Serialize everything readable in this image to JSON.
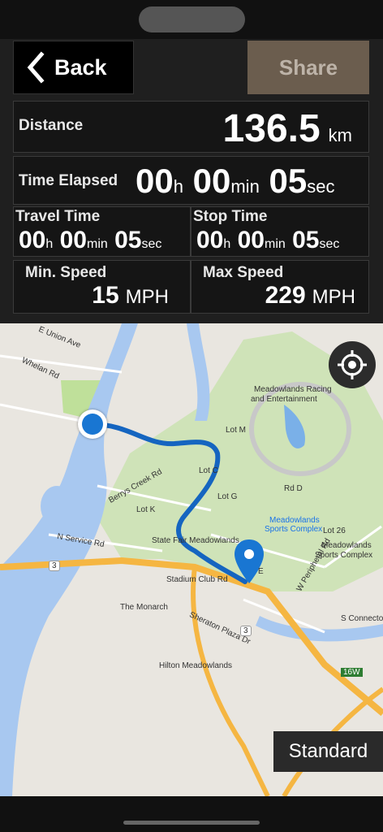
{
  "header": {
    "back_label": "Back",
    "share_label": "Share"
  },
  "stats": {
    "distance": {
      "label": "Distance",
      "value": "136.5",
      "unit": "km"
    },
    "time_elapsed": {
      "label": "Time Elapsed",
      "h": "00",
      "h_unit": "h",
      "min": "00",
      "min_unit": "min",
      "sec": "05",
      "sec_unit": "sec"
    },
    "travel_time": {
      "label": "Travel Time",
      "h": "00",
      "h_unit": "h",
      "min": "00",
      "min_unit": "min",
      "sec": "05",
      "sec_unit": "sec"
    },
    "stop_time": {
      "label": "Stop Time",
      "h": "00",
      "h_unit": "h",
      "min": "00",
      "min_unit": "min",
      "sec": "05",
      "sec_unit": "sec"
    },
    "min_speed": {
      "label": "Min. Speed",
      "value": "15",
      "unit": "MPH"
    },
    "max_speed": {
      "label": "Max Speed",
      "value": "229",
      "unit": "MPH"
    }
  },
  "map": {
    "labels": {
      "e_union_ave": "E Union Ave",
      "whelan_rd": "Whelan Rd",
      "meadowlands_racing": "Meadowlands Racing",
      "and_entertainment": "and Entertainment",
      "lot_m": "Lot M",
      "lot_g": "Lot G",
      "lot_k": "Lot K",
      "lot_c": "Lot C",
      "state_fair": "State Fair Meadowlands",
      "meadowlands_sports_complex": "Meadowlands",
      "sports_complex_2": "Sports Complex",
      "lot_26": "Lot 26",
      "meadowlands_sc_right_1": "Meadowlands",
      "meadowlands_sc_right_2": "Sports Complex",
      "n_service_rd": "N Service Rd",
      "berrys_creek_rd": "Berrys Creek Rd",
      "stadium_club_rd": "Stadium Club Rd",
      "the_monarch": "The Monarch",
      "sheraton_plaza_dr": "Sheraton Plaza Dr",
      "hilton_meadowlands": "Hilton Meadowlands",
      "s_connector": "S Connector",
      "w_peripheral_rd": "W Peripheral Rd",
      "rd_d": "Rd D",
      "lot_e": "E",
      "route_3_a": "3",
      "route_3_b": "3",
      "route_16w": "16W"
    },
    "map_type_label": "Standard",
    "colors": {
      "route": "#1565c0",
      "water": "#a8c8f0",
      "park": "#cfe3b8",
      "highway": "#f5b642"
    }
  }
}
